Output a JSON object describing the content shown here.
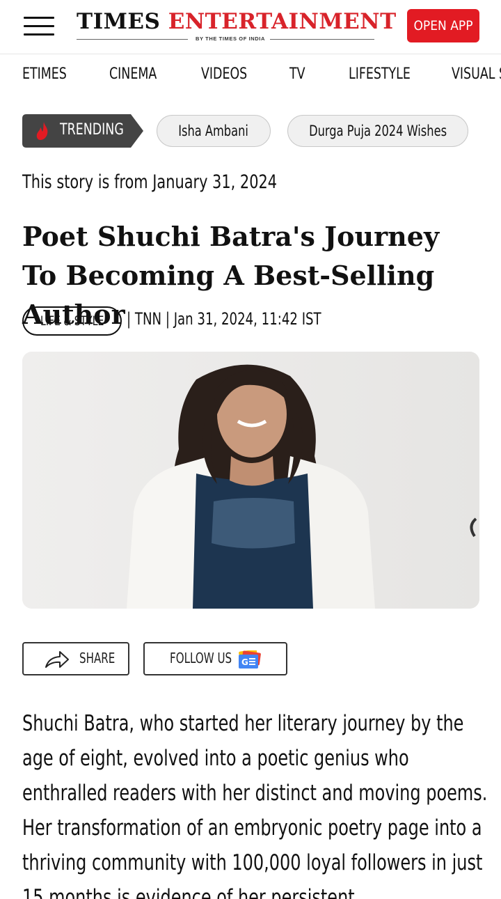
{
  "header": {
    "logo_word1": "TIMES",
    "logo_word2": "ENTERTAINMENT",
    "logo_tagline": "BY THE TIMES OF INDIA",
    "open_app_label": "OPEN APP",
    "brand_color": "#e21b23"
  },
  "nav": {
    "items": [
      "ETIMES",
      "CINEMA",
      "VIDEOS",
      "TV",
      "LIFESTYLE",
      "VISUAL S"
    ]
  },
  "trending": {
    "badge_label": "TRENDING",
    "topics": [
      "Isha Ambani",
      "Durga Puja 2024 Wishes"
    ]
  },
  "story": {
    "date_notice": "This story is from January 31, 2024",
    "headline": "Poet Shuchi Batra's Journey To Becoming A Best-Selling Author",
    "category": "LIFE & STYLE",
    "byline": "| TNN | Jan 31, 2024, 11:42 IST"
  },
  "actions": {
    "share_label": "SHARE",
    "follow_label": "FOLLOW US"
  },
  "article": {
    "body": "Shuchi Batra, who started her literary journey by the age of eight, evolved into a poetic genius who enthralled readers with her distinct and moving poems. Her transformation of an embryonic poetry page into a thriving community with 100,000 loyal followers in just 15 months is evidence of her persistent"
  }
}
